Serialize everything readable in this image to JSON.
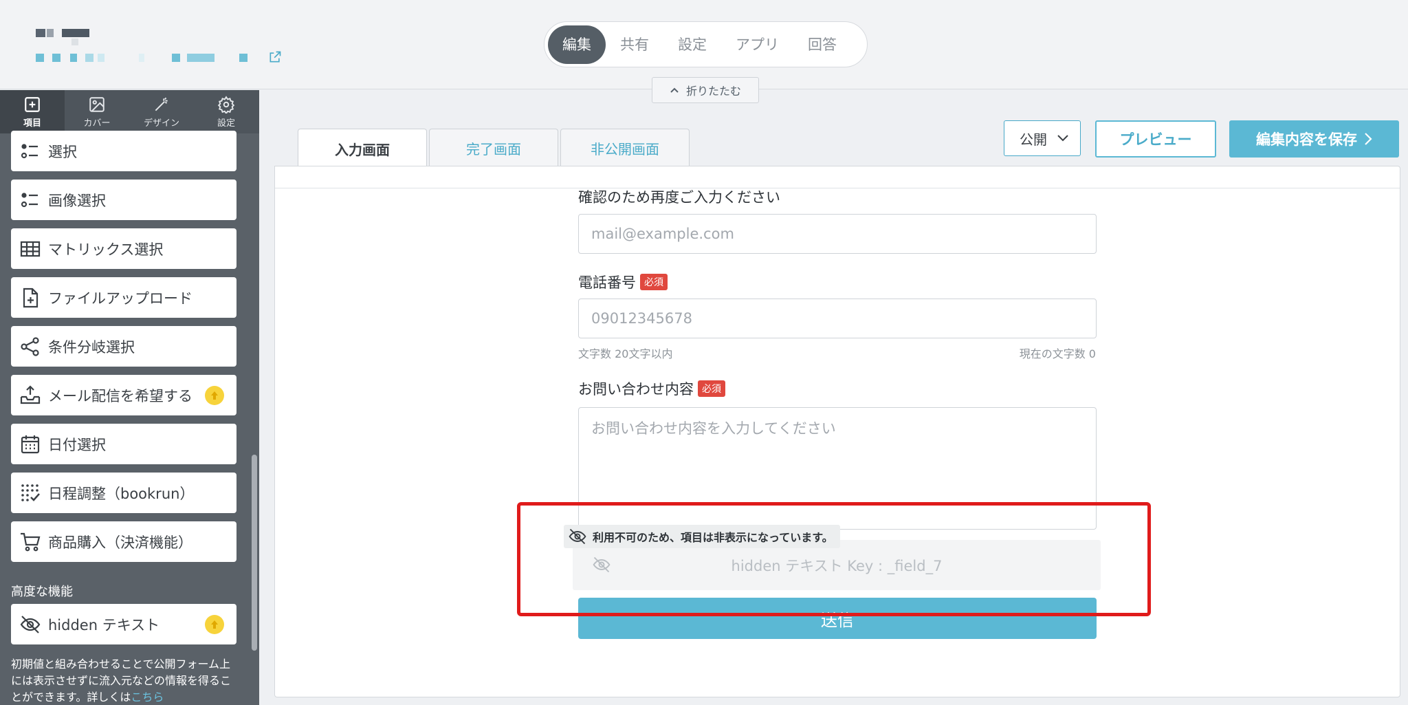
{
  "header": {
    "tabs": [
      {
        "label": "編集",
        "active": true
      },
      {
        "label": "共有"
      },
      {
        "label": "設定"
      },
      {
        "label": "アプリ"
      },
      {
        "label": "回答"
      }
    ],
    "collapse_label": "折りたたむ"
  },
  "sidebar": {
    "tabs": [
      {
        "label": "項目",
        "icon": "plus-square-icon",
        "active": true
      },
      {
        "label": "カバー",
        "icon": "image-icon"
      },
      {
        "label": "デザイン",
        "icon": "magic-wand-icon"
      },
      {
        "label": "設定",
        "icon": "gear-icon"
      }
    ],
    "items": [
      {
        "label": "選択",
        "icon": "list-icon"
      },
      {
        "label": "画像選択",
        "icon": "list-icon"
      },
      {
        "label": "マトリックス選択",
        "icon": "table-icon"
      },
      {
        "label": "ファイルアップロード",
        "icon": "file-plus-icon"
      },
      {
        "label": "条件分岐選択",
        "icon": "share-icon"
      },
      {
        "label": "メール配信を希望する",
        "icon": "inbox-upload-icon",
        "upgrade": true
      },
      {
        "label": "日付選択",
        "icon": "calendar-icon"
      },
      {
        "label": "日程調整（bookrun）",
        "icon": "dot-grid-check-icon"
      },
      {
        "label": "商品購入（決済機能）",
        "icon": "cart-icon"
      }
    ],
    "advanced_label": "高度な機能",
    "advanced_items": [
      {
        "label": "hidden テキスト",
        "icon": "eye-off-icon",
        "upgrade": true
      }
    ],
    "description": "初期値と組み合わせることで公開フォーム上には表示させずに流入元などの情報を得ることができます。詳しくは",
    "description_link": "こちら"
  },
  "toolbar": {
    "page_tabs": [
      {
        "label": "入力画面",
        "active": true
      },
      {
        "label": "完了画面"
      },
      {
        "label": "非公開画面"
      }
    ],
    "publish_select": "公開",
    "preview_label": "プレビュー",
    "save_label": "編集内容を保存"
  },
  "form": {
    "confirm_email_label": "確認のため再度ご入力ください",
    "confirm_email_placeholder": "mail@example.com",
    "phone_label": "電話番号",
    "required_badge": "必須",
    "phone_placeholder": "09012345678",
    "phone_hint_left": "文字数 20文字以内",
    "phone_hint_right": "現在の文字数 0",
    "inquiry_label": "お問い合わせ内容",
    "inquiry_placeholder": "お問い合わせ内容を入力してください",
    "hidden_notice": "利用不可のため、項目は非表示になっています。",
    "hidden_field_text": "hidden テキスト Key : _field_7",
    "submit_label": "送信"
  },
  "colors": {
    "accent": "#5bb8d4",
    "required": "#e0483e",
    "highlight": "#e01b1b",
    "upgrade_badge": "#f7d33b"
  }
}
